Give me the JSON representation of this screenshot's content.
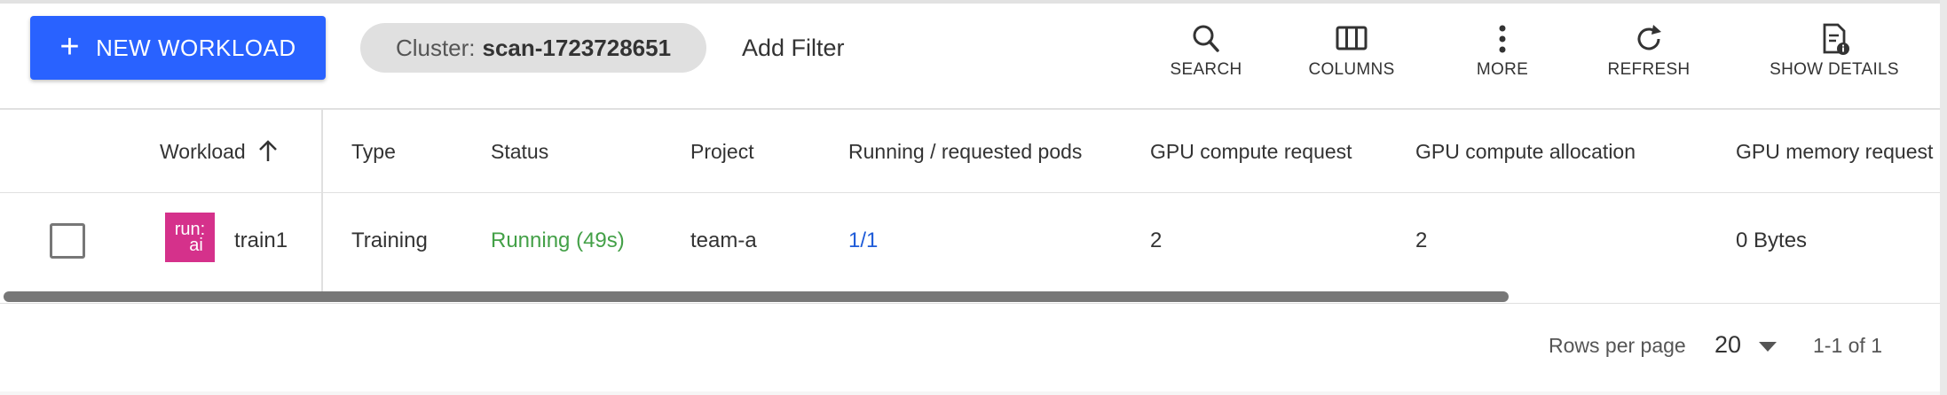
{
  "toolbar": {
    "new_workload_label": "NEW WORKLOAD",
    "new_workload_icon": "plus-icon",
    "cluster_filter_prefix": "Cluster:",
    "cluster_filter_value": "scan-1723728651",
    "add_filter_label": "Add Filter",
    "actions": [
      {
        "label": "SEARCH",
        "icon": "search-icon"
      },
      {
        "label": "COLUMNS",
        "icon": "columns-icon"
      },
      {
        "label": "MORE",
        "icon": "more-vert-icon"
      },
      {
        "label": "REFRESH",
        "icon": "refresh-icon"
      },
      {
        "label": "SHOW DETAILS",
        "icon": "details-icon"
      }
    ],
    "accent_color": "#2962ff"
  },
  "table": {
    "columns": [
      {
        "label": "Workload",
        "sort": "ascending",
        "sort_icon": "arrow-up-icon"
      },
      {
        "label": "Type"
      },
      {
        "label": "Status"
      },
      {
        "label": "Project"
      },
      {
        "label": "Running / requested pods"
      },
      {
        "label": "GPU compute request"
      },
      {
        "label": "GPU compute allocation"
      },
      {
        "label": "GPU memory request"
      }
    ],
    "rows": [
      {
        "selected": false,
        "logo_text_top": "run:",
        "logo_text_bottom": "ai",
        "workload": "train1",
        "type": "Training",
        "status": "Running (49s)",
        "status_color": "#43a047",
        "project": "team-a",
        "pods": "1/1",
        "gpu_compute_request": "2",
        "gpu_compute_allocation": "2",
        "gpu_memory_request": "0 Bytes"
      }
    ]
  },
  "pagination": {
    "rows_per_page_label": "Rows per page",
    "rows_per_page_value": "20",
    "range_text": "1-1 of 1"
  }
}
